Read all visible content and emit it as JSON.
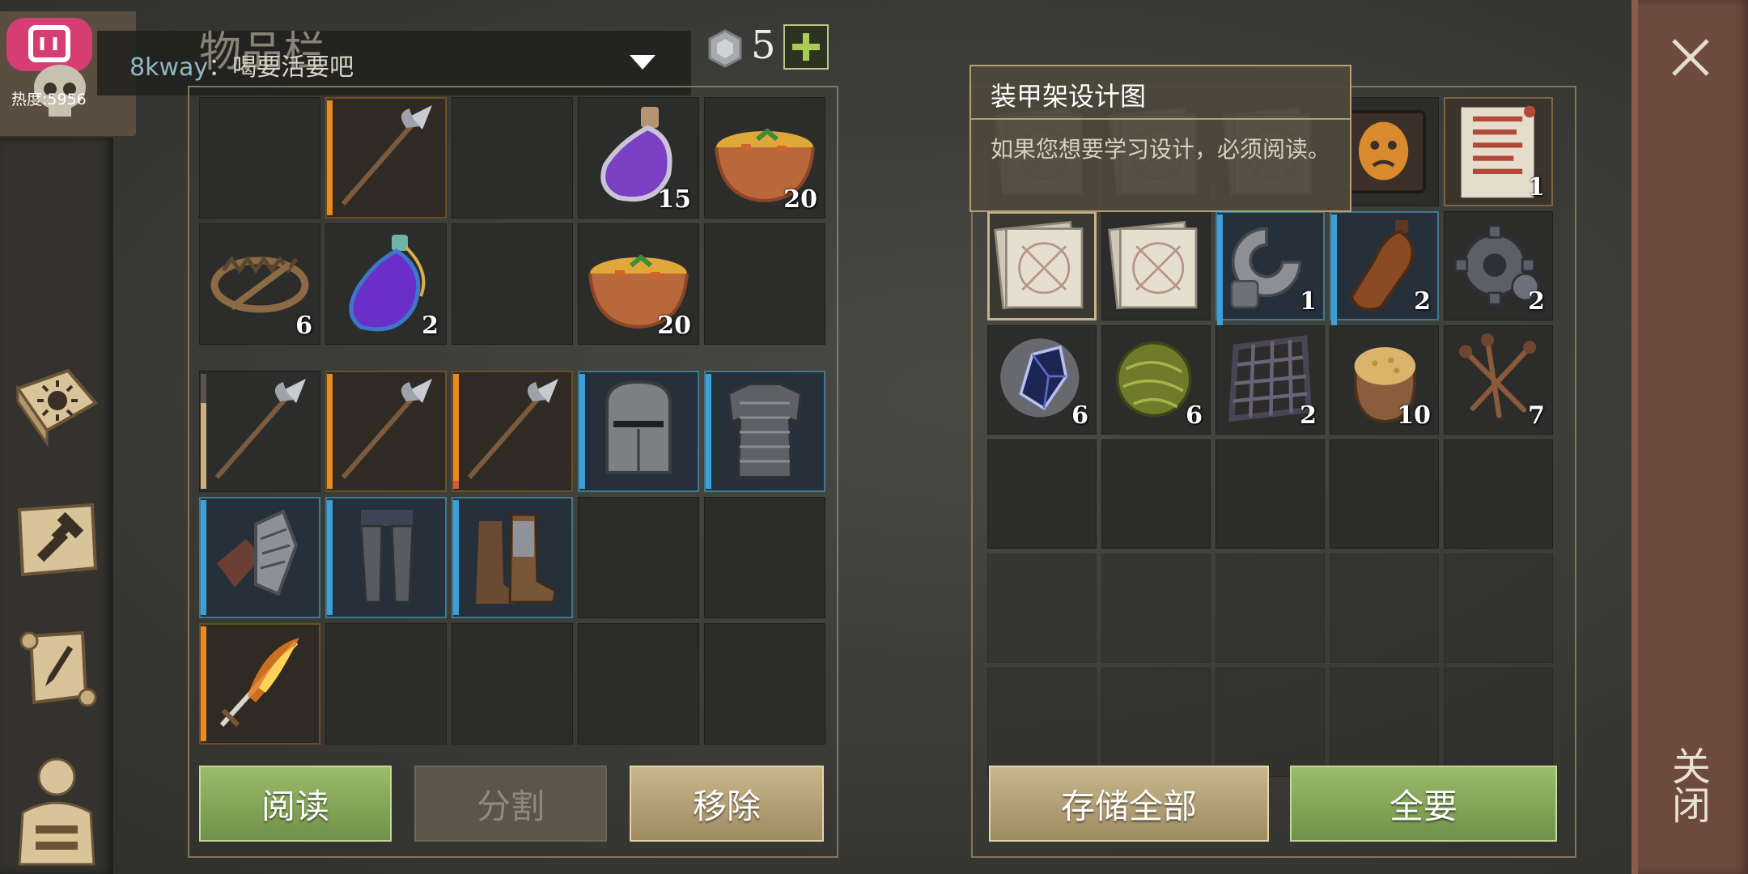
{
  "stream": {
    "heat_label": "热度:5956",
    "chat_user": "8kway",
    "chat_message": "：喝要活要吧"
  },
  "inventory": {
    "title": "物品栏",
    "coins": "5",
    "equipped_grid": [
      {
        "icon": "empty-icon",
        "count": ""
      },
      {
        "icon": "halberd-icon",
        "count": "",
        "rarity": "orange"
      },
      {
        "icon": "empty-icon",
        "count": ""
      },
      {
        "icon": "purple-potion-icon",
        "count": "15"
      },
      {
        "icon": "soup-bowl-icon",
        "count": "20"
      },
      {
        "icon": "bear-trap-icon",
        "count": "6"
      },
      {
        "icon": "elixir-flask-icon",
        "count": "2"
      },
      {
        "icon": "empty-icon",
        "count": ""
      },
      {
        "icon": "soup-bowl-icon",
        "count": "20"
      },
      {
        "icon": "empty-icon",
        "count": ""
      }
    ],
    "bag_grid": [
      {
        "icon": "halberd-icon",
        "count": ""
      },
      {
        "icon": "halberd-icon",
        "count": ""
      },
      {
        "icon": "halberd-icon",
        "count": ""
      },
      {
        "icon": "knight-helmet-icon",
        "count": ""
      },
      {
        "icon": "chainmail-icon",
        "count": ""
      },
      {
        "icon": "gauntlets-icon",
        "count": ""
      },
      {
        "icon": "leg-armor-icon",
        "count": ""
      },
      {
        "icon": "boots-icon",
        "count": ""
      },
      {
        "icon": "empty-icon",
        "count": ""
      },
      {
        "icon": "empty-icon",
        "count": ""
      },
      {
        "icon": "flaming-sword-icon",
        "count": ""
      },
      {
        "icon": "empty-icon",
        "count": ""
      },
      {
        "icon": "empty-icon",
        "count": ""
      },
      {
        "icon": "empty-icon",
        "count": ""
      },
      {
        "icon": "empty-icon",
        "count": ""
      }
    ],
    "buttons": {
      "read": "阅读",
      "split": "分割",
      "remove": "移除"
    }
  },
  "storage": {
    "tooltip": {
      "title": "装甲架设计图",
      "description": "如果您想要学习设计，必须阅读。"
    },
    "grid": [
      {
        "icon": "blueprint-paper-icon",
        "count": ""
      },
      {
        "icon": "blueprint-paper-icon",
        "count": ""
      },
      {
        "icon": "blueprint-paper-icon",
        "count": ""
      },
      {
        "icon": "mask-book-icon",
        "count": ""
      },
      {
        "icon": "scroll-icon",
        "count": "1"
      },
      {
        "icon": "blueprint-paper-icon",
        "count": ""
      },
      {
        "icon": "blueprint-paper-icon",
        "count": ""
      },
      {
        "icon": "metal-clamp-icon",
        "count": "1"
      },
      {
        "icon": "leather-bottle-icon",
        "count": "2"
      },
      {
        "icon": "gear-icon",
        "count": "2"
      },
      {
        "icon": "crystal-icon",
        "count": "6"
      },
      {
        "icon": "fiber-ball-icon",
        "count": "6"
      },
      {
        "icon": "iron-grate-icon",
        "count": "2"
      },
      {
        "icon": "grain-sack-icon",
        "count": "10"
      },
      {
        "icon": "nails-icon",
        "count": "7"
      }
    ],
    "buttons": {
      "store_all": "存储全部",
      "take_all": "全要"
    }
  },
  "close_label": "关闭",
  "colors": {
    "rarity_orange": "#e88a20",
    "rarity_blue": "#3d9fd8",
    "button_green": "#8aae5e"
  }
}
